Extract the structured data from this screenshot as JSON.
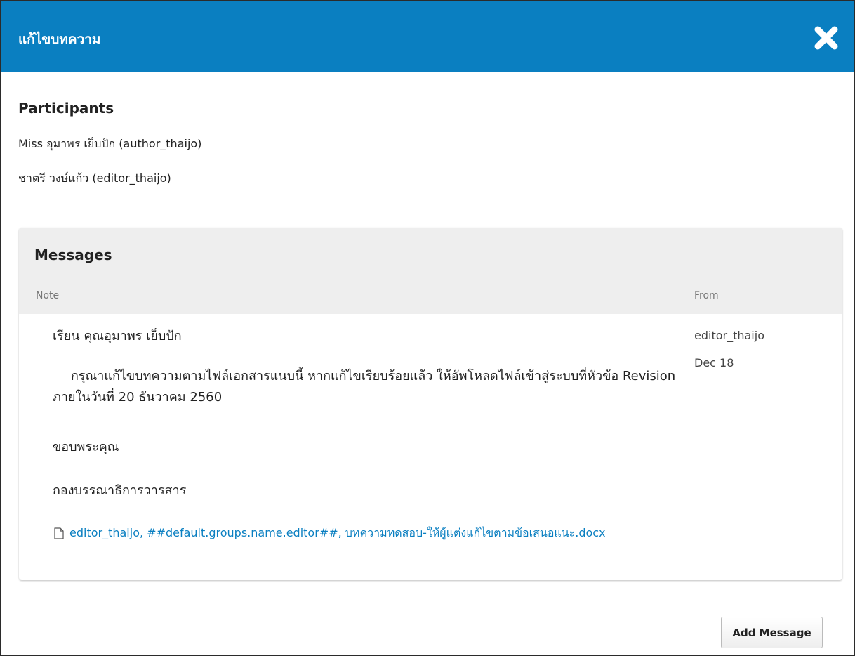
{
  "modal": {
    "title": "แก้ไขบทความ",
    "close_icon": "close-icon"
  },
  "participants": {
    "heading": "Participants",
    "items": [
      "Miss อุมาพร เย็บปัก (author_thaijo)",
      "ชาตรี วงษ์แก้ว (editor_thaijo)"
    ]
  },
  "messages": {
    "heading": "Messages",
    "columns": {
      "note": "Note",
      "from": "From"
    },
    "items": [
      {
        "salutation": "เรียน คุณอุมาพร เย็บปัก",
        "body": "กรุณาแก้ไขบทความตามไฟล์เอกสารแนบนี้ หากแก้ไขเรียบร้อยแล้ว ให้อัพโหลดไฟล์เข้าสู่ระบบที่หัวข้อ Revision ภายในวันที่ 20 ธันวาคม 2560",
        "thanks": "ขอบพระคุณ",
        "signature": "กองบรรณาธิการวารสาร",
        "attachment": "editor_thaijo, ##default.groups.name.editor##, บทความทดสอบ-ให้ผู้แต่งแก้ไขตามข้อเสนอแนะ.docx",
        "from": "editor_thaijo",
        "date": "Dec 18"
      }
    ]
  },
  "actions": {
    "add_message": "Add Message"
  },
  "colors": {
    "header_bg": "#0a7fc1",
    "link": "#0a7fc1",
    "panel_head_bg": "#eeeeee"
  }
}
